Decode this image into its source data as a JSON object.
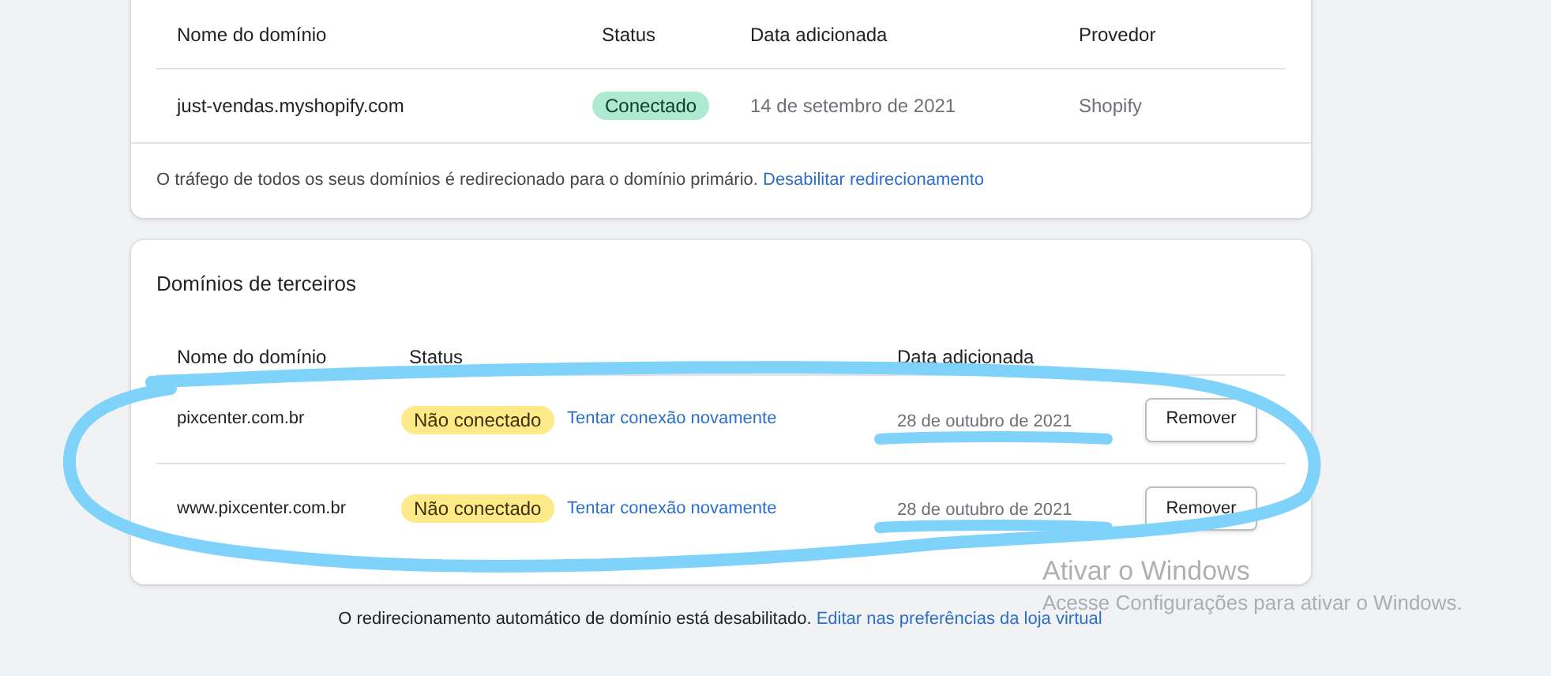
{
  "primary_domains": {
    "columns": [
      "Nome do domínio",
      "Status",
      "Data adicionada",
      "Provedor"
    ],
    "rows": [
      {
        "domain": "just-vendas.myshopify.com",
        "status": "Conectado",
        "kind": "success",
        "date": "14 de setembro de 2021",
        "provider": "Shopify"
      }
    ],
    "footer": {
      "text": "O tráfego de todos os seus domínios é redirecionado para o domínio primário.",
      "link": "Desabilitar redirecionamento"
    }
  },
  "third_party_domains": {
    "title": "Domínios de terceiros",
    "columns": [
      "Nome do domínio",
      "Status",
      "Data adicionada"
    ],
    "circled": true,
    "rows": [
      {
        "domain": "pixcenter.com.br",
        "status": "Não conectado",
        "kind": "warning",
        "action_link": "Tentar conexão novamente",
        "date": "28 de outubro de 2021",
        "date_underlined": true,
        "button": "Remover"
      },
      {
        "domain": "www.pixcenter.com.br",
        "status": "Não conectado",
        "kind": "warning",
        "action_link": "Tentar conexão novamente",
        "date": "28 de outubro de 2021",
        "date_underlined": true,
        "button": "Remover"
      }
    ]
  },
  "page_footer": {
    "text": "O redirecionamento automático de domínio está desabilitado.",
    "link": "Editar nas preferências da loja virtual"
  },
  "os_notice": {
    "title": "Ativar o Windows",
    "text": "Acesse Configurações para ativar o Windows."
  }
}
